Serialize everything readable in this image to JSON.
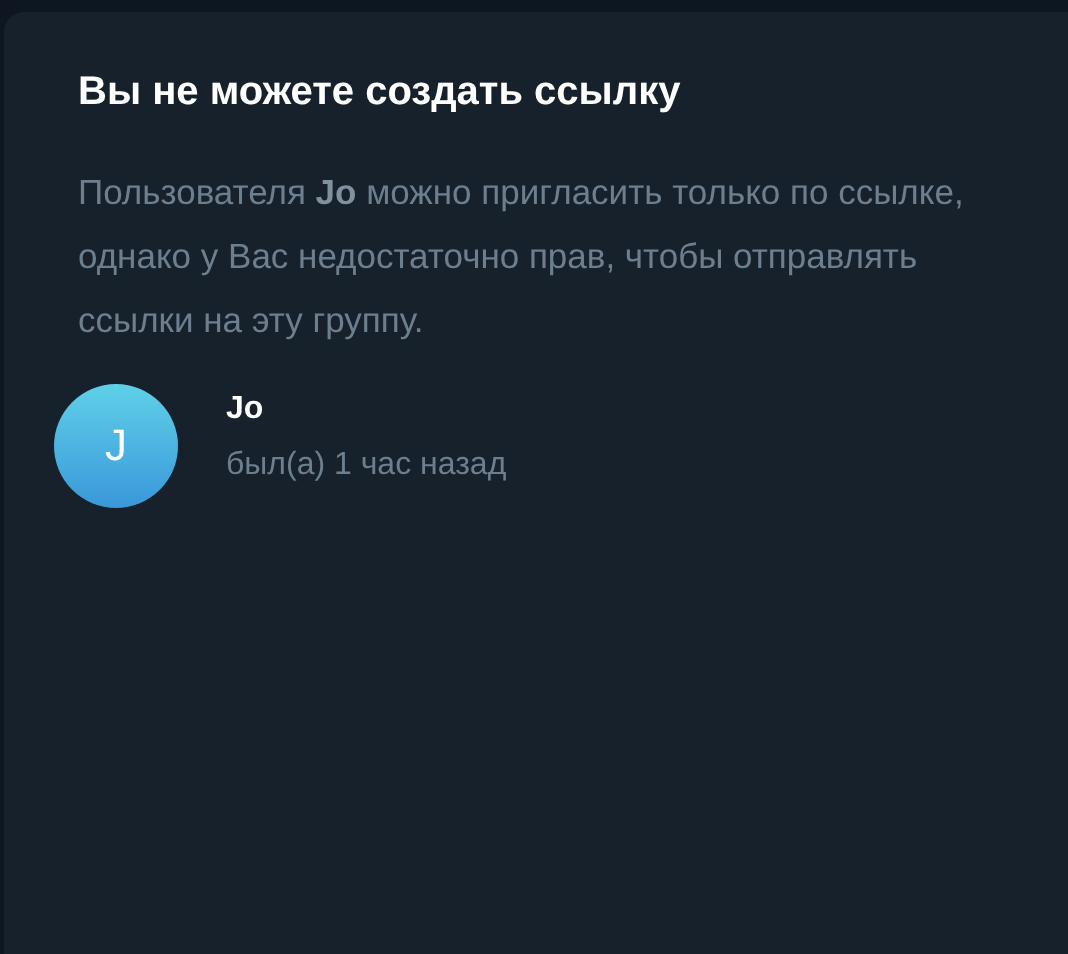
{
  "dialog": {
    "title": "Вы не можете создать ссылку",
    "message": "Пользователя **Jo** можно пригласить только по ссылке, однако у Вас недостаточно прав, чтобы отправлять ссылки на эту группу.",
    "user": {
      "initial": "J",
      "name": "Jo",
      "status": "был(а) 1 час назад"
    }
  }
}
